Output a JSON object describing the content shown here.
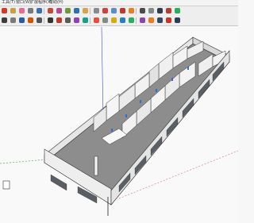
{
  "menu": [
    {
      "label": "工具(T)"
    },
    {
      "label": "窗口(W)"
    },
    {
      "label": "扩展程序(X)"
    },
    {
      "label": "帮助(H)"
    }
  ],
  "toolbar": {
    "row1": [
      {
        "icon": "red-circle-icon",
        "color": "#d33a2c"
      },
      {
        "icon": "paint-bucket-icon",
        "color": "#c9a13a"
      },
      {
        "icon": "eraser-icon",
        "color": "#e56a9a"
      },
      {
        "icon": "tape-measure-icon",
        "color": "#7a7a7a"
      },
      {
        "icon": "rotate-icon",
        "color": "#3b6fb5"
      },
      {
        "icon": "scale-icon",
        "color": "#c14a3a"
      },
      {
        "icon": "follow-me-icon",
        "color": "#b44a8f"
      },
      {
        "icon": "offset-icon",
        "color": "#6a9a3a"
      },
      {
        "icon": "orbit-icon",
        "color": "#2f6db5"
      },
      {
        "icon": "pan-icon",
        "color": "#d6a347"
      },
      {
        "icon": "zoom-icon",
        "color": "#8a8a8a"
      },
      {
        "icon": "zoom-extents-icon",
        "color": "#d14040"
      },
      {
        "icon": "walk-icon",
        "color": "#5d8dc7"
      },
      {
        "icon": "component-icon",
        "color": "#c0392b"
      },
      {
        "icon": "section-plane-icon",
        "color": "#e67e22"
      },
      {
        "icon": "camera-icon",
        "color": "#4a4a4a"
      },
      {
        "icon": "shadow-icon",
        "color": "#7f8c8d"
      },
      {
        "icon": "x-ray-icon",
        "color": "#2c3e50"
      },
      {
        "icon": "styles-icon",
        "color": "#c0392b"
      },
      {
        "icon": "layers-icon",
        "color": "#27ae60"
      }
    ],
    "row2": [
      {
        "icon": "select-icon",
        "color": "#3d3d3d"
      },
      {
        "icon": "gear-icon",
        "color": "#7a7a7a"
      },
      {
        "icon": "move-icon",
        "color": "#2c5aa0"
      },
      {
        "icon": "push-pull-icon",
        "color": "#d35400"
      },
      {
        "icon": "rectangle-icon",
        "color": "#555555"
      },
      {
        "icon": "line-icon",
        "color": "#333333"
      },
      {
        "icon": "arc-icon",
        "color": "#c0392b"
      },
      {
        "icon": "text-icon",
        "color": "#5a5a5a"
      },
      {
        "icon": "dimension-icon",
        "color": "#8e44ad"
      },
      {
        "icon": "protractor-icon",
        "color": "#16a085"
      },
      {
        "icon": "axes-icon",
        "color": "#e74c3c"
      },
      {
        "icon": "solid-tools-icon",
        "color": "#7f8c8d"
      },
      {
        "icon": "sandbox-icon",
        "color": "#d4ac0d"
      },
      {
        "icon": "warehouse-icon",
        "color": "#2980b9"
      },
      {
        "icon": "geo-location-icon",
        "color": "#27ae60"
      },
      {
        "icon": "extension-icon",
        "color": "#8e44ad"
      },
      {
        "icon": "match-photo-icon",
        "color": "#e67e22"
      },
      {
        "icon": "iso-view-icon",
        "color": "#34495e"
      },
      {
        "icon": "top-view-icon",
        "color": "#c0392b"
      },
      {
        "icon": "front-view-icon",
        "color": "#2c3e50"
      }
    ]
  },
  "colors": {
    "wall": "#ececec",
    "wall_dark": "#b9b9b9",
    "floor": "#8c8c8c",
    "window": "#5a5f66",
    "accent": "#2f6fd1",
    "axis_blue": "#3a49d4",
    "axis_green": "#3aa04a"
  }
}
